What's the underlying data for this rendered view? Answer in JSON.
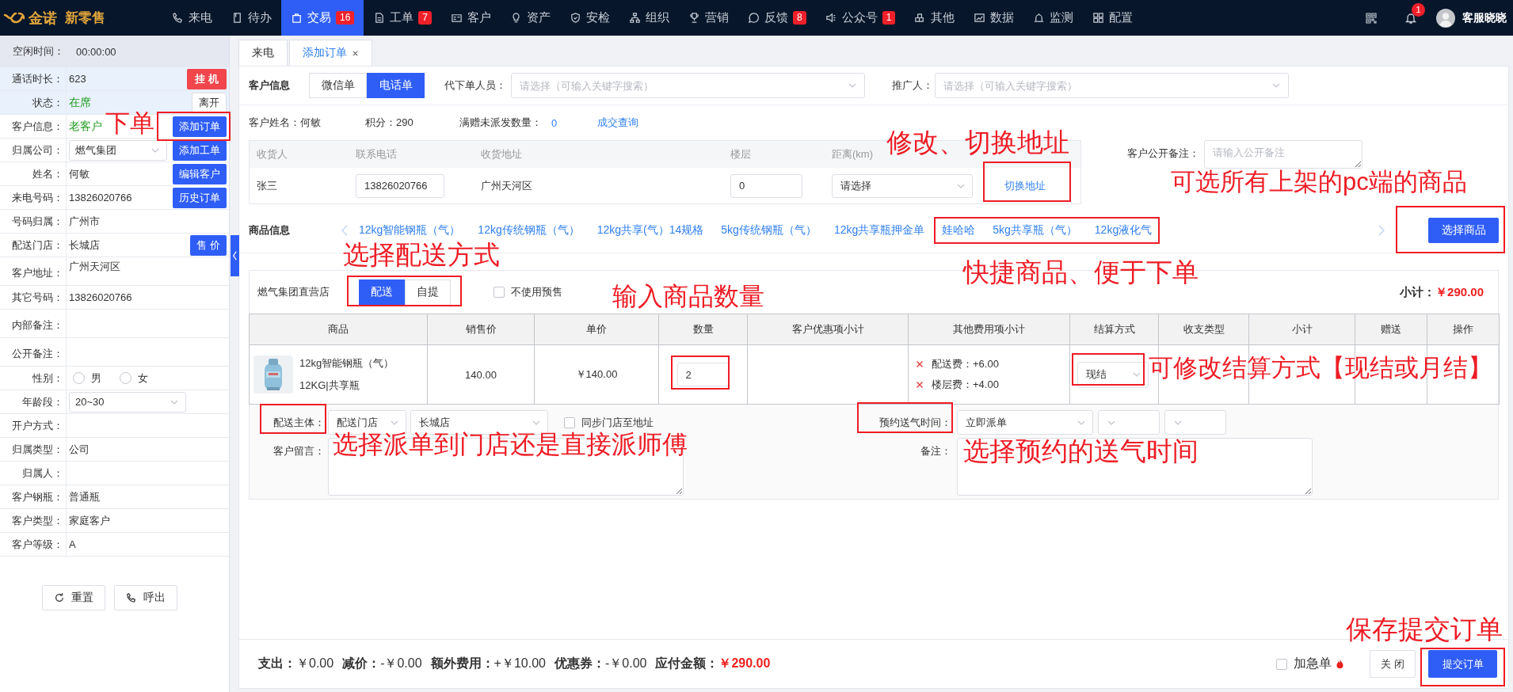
{
  "topbar": {
    "logo": "金诺",
    "product": "新零售",
    "nav": [
      {
        "label": "来电",
        "selected": false
      },
      {
        "label": "待办",
        "selected": false
      },
      {
        "label": "交易",
        "selected": true,
        "badge": "16"
      },
      {
        "label": "工单",
        "selected": false,
        "badge": "7"
      },
      {
        "label": "客户",
        "selected": false
      },
      {
        "label": "资产",
        "selected": false
      },
      {
        "label": "安检",
        "selected": false
      },
      {
        "label": "组织",
        "selected": false
      },
      {
        "label": "营销",
        "selected": false
      },
      {
        "label": "反馈",
        "selected": false,
        "badge": "8"
      },
      {
        "label": "公众号",
        "selected": false,
        "badge": "1"
      },
      {
        "label": "其他",
        "selected": false
      },
      {
        "label": "数据",
        "selected": false
      },
      {
        "label": "监测",
        "selected": false
      },
      {
        "label": "配置",
        "selected": false
      }
    ],
    "notification_badge": "1",
    "user": "客服晓晓"
  },
  "sidebar": {
    "idle": {
      "label": "空闲时间：",
      "value": "00:00:00"
    },
    "rows": [
      {
        "kind": "text",
        "label": "通话时长：",
        "value": "623",
        "highlighted": true,
        "action": {
          "label": "挂 机",
          "kind": "danger"
        }
      },
      {
        "kind": "text",
        "label": "状态：",
        "value": "在席",
        "color": "#1e9a1e",
        "highlighted": true,
        "action": {
          "label": "离开",
          "kind": "plain"
        }
      },
      {
        "kind": "text",
        "label": "客户信息：",
        "value": "老客户",
        "color": "#1e9a1e",
        "highlighted": false,
        "action": {
          "label": "添加订单",
          "kind": "primary"
        }
      },
      {
        "kind": "select",
        "label": "归属公司：",
        "value": "燃气集团",
        "highlighted": false,
        "action": {
          "label": "添加工单",
          "kind": "primary"
        }
      },
      {
        "kind": "text",
        "label": "姓名：",
        "value": "何敏",
        "highlighted": false,
        "action": {
          "label": "编辑客户",
          "kind": "primary"
        }
      },
      {
        "kind": "text",
        "label": "来电号码：",
        "value": "13826020766",
        "highlighted": false,
        "action": {
          "label": "历史订单",
          "kind": "primary"
        }
      },
      {
        "kind": "text",
        "label": "号码归属：",
        "value": "广州市",
        "highlighted": false
      },
      {
        "kind": "text",
        "label": "配送门店：",
        "value": "长城店",
        "highlighted": false,
        "action": {
          "label": "售 价",
          "kind": "primary"
        }
      },
      {
        "kind": "tall",
        "label": "客户地址：",
        "value": "广州天河区",
        "highlighted": false
      },
      {
        "kind": "text",
        "label": "其它号码：",
        "value": "13826020766",
        "highlighted": false
      },
      {
        "kind": "tall",
        "label": "内部备注：",
        "highlighted": false
      },
      {
        "kind": "tall",
        "label": "公开备注：",
        "highlighted": false
      },
      {
        "kind": "radio",
        "label": "性别：",
        "highlighted": false,
        "options": [
          {
            "label": "男",
            "selected": false
          },
          {
            "label": "女",
            "selected": false
          }
        ]
      },
      {
        "kind": "select",
        "label": "年龄段：",
        "value": "20~30",
        "highlighted": false
      },
      {
        "kind": "text",
        "label": "开户方式：",
        "highlighted": false
      },
      {
        "kind": "text",
        "label": "归属类型：",
        "value": "公司",
        "highlighted": false
      },
      {
        "kind": "text",
        "label": "归属人：",
        "highlighted": false
      },
      {
        "kind": "text",
        "label": "客户钢瓶：",
        "value": "普通瓶",
        "highlighted": false
      },
      {
        "kind": "text",
        "label": "客户类型：",
        "value": "家庭客户",
        "highlighted": false
      },
      {
        "kind": "text",
        "label": "客户等级：",
        "value": "A",
        "highlighted": false
      }
    ],
    "buttons": [
      {
        "label": "重置"
      },
      {
        "label": "呼出"
      }
    ]
  },
  "tabs": [
    {
      "label": "来电",
      "selected": false
    },
    {
      "label": "添加订单",
      "selected": true
    }
  ],
  "customer": {
    "label": "客户信息",
    "order_types": [
      {
        "label": "微信单",
        "selected": false
      },
      {
        "label": "电话单",
        "selected": true
      }
    ],
    "agent": {
      "label": "代下单人员：",
      "placeholder": "请选择（可输入关键字搜索）"
    },
    "promoter": {
      "label": "推广人：",
      "placeholder": "请选择（可输入关键字搜索）"
    }
  },
  "summary": {
    "name": "客户姓名：何敏",
    "points": "积分：290",
    "gift_label": "满赠未派发数量：",
    "gift_value": "0",
    "link": "成交查询"
  },
  "address": {
    "columns": [
      "收货人",
      "联系电话",
      "收货地址",
      "楼层",
      "距离(km)"
    ],
    "consignee": "张三",
    "phone": "13826020766",
    "address": "广州天河区",
    "floor": "0",
    "distance_placeholder": "请选择",
    "action": "切换地址"
  },
  "public_note": {
    "label": "客户公开备注：",
    "placeholder": "请输入公开备注"
  },
  "goods": {
    "label": "商品信息",
    "quick": [
      "12kg智能钢瓶（气）",
      "12kg传统钢瓶（气）",
      "12kg共享(气）14规格",
      "5kg传统钢瓶（气）",
      "12kg共享瓶押金单",
      "娃哈哈",
      "5kg共享瓶（气）",
      "12kg液化气"
    ],
    "select_button": "选择商品"
  },
  "order": {
    "store": "燃气集团直营店",
    "delivery": [
      {
        "label": "配送",
        "selected": true
      },
      {
        "label": "自提",
        "selected": false
      }
    ],
    "presale": {
      "label": "不使用预售",
      "checked": false
    },
    "subtotal_label": "小计：",
    "subtotal": "￥290.00",
    "columns": [
      "商品",
      "销售价",
      "单价",
      "数量",
      "客户优惠项小计",
      "其他费用项小计",
      "结算方式",
      "收支类型",
      "小计",
      "赠送",
      "操作"
    ],
    "item": {
      "name": "12kg智能钢瓶（气）",
      "spec": "12KG|共享瓶",
      "sale_price": "140.00",
      "unit_price": "￥140.00",
      "quantity": "2",
      "fees": [
        {
          "label": "配送费：",
          "value": "+6.00"
        },
        {
          "label": "楼层费：",
          "value": "+4.00"
        }
      ],
      "settlement": "现结"
    },
    "dispatch_label": "配送主体：",
    "dispatch_type": "配送门店",
    "dispatch_store": "长城店",
    "sync": {
      "label": "同步门店至地址",
      "checked": false
    },
    "time_label": "预约送气时间：",
    "time_value": "立即派单",
    "message_label": "客户留言：",
    "remark_label": "备注："
  },
  "footer": {
    "totals": [
      {
        "label": "支出：",
        "value": "￥0.00",
        "emphasis": false
      },
      {
        "label": "减价：",
        "value": "-￥0.00",
        "emphasis": false
      },
      {
        "label": "额外费用：",
        "value": "+￥10.00",
        "emphasis": false
      },
      {
        "label": "优惠券：",
        "value": "-￥0.00",
        "emphasis": false
      },
      {
        "label": "应付金额：",
        "value": "￥290.00",
        "emphasis": true
      }
    ],
    "urgent": {
      "label": "加急单",
      "checked": false
    },
    "buttons": [
      {
        "label": "关 闭",
        "kind": "plain"
      },
      {
        "label": "提交订单",
        "kind": "primary"
      }
    ]
  },
  "annotations": [
    "下单",
    "修改、切换地址",
    "可选所有上架的pc端的商品",
    "快捷商品、便于下单",
    "选择配送方式",
    "输入商品数量",
    "可修改结算方式【现结或月结】",
    "选择派单到门店还是直接派师傅",
    "选择预约的送气时间",
    "保存提交订单"
  ]
}
